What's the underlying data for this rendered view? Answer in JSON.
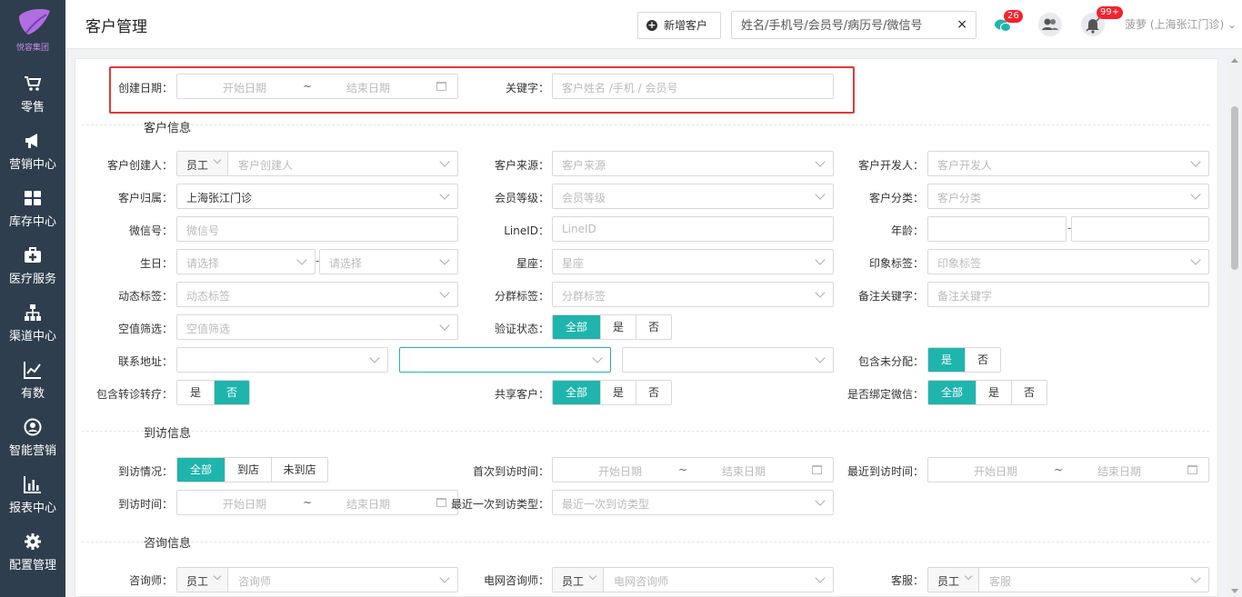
{
  "brand": {
    "logo_text": "悦容集团",
    "accent": "#1fb5ad",
    "sidebar_bg": "#2f3e4e"
  },
  "sidebar": {
    "items": [
      {
        "label": "零售",
        "icon": "cart-icon"
      },
      {
        "label": "营销中心",
        "icon": "megaphone-icon"
      },
      {
        "label": "库存中心",
        "icon": "grid-icon"
      },
      {
        "label": "医疗服务",
        "icon": "medkit-icon"
      },
      {
        "label": "渠道中心",
        "icon": "sitemap-icon"
      },
      {
        "label": "有数",
        "icon": "line-chart-icon"
      },
      {
        "label": "智能营销",
        "icon": "user-circle-icon"
      },
      {
        "label": "报表中心",
        "icon": "bar-chart-icon"
      },
      {
        "label": "配置管理",
        "icon": "gear-icon"
      }
    ]
  },
  "header": {
    "title": "客户管理",
    "new_button": "新增客户",
    "search_placeholder": "姓名/手机号/会员号/病历号/微信号",
    "clear": "×",
    "wechat_badge": "26",
    "notify_badge": "99+",
    "user": "菠萝 (上海张江门诊) ⌄"
  },
  "filters": {
    "top": {
      "create_date_label": "创建日期：",
      "start_date": "开始日期",
      "tilde": "~",
      "end_date": "结束日期",
      "keyword_label": "关键字：",
      "keyword_placeholder": "客户姓名 /手机 / 会员号"
    },
    "customer_info": {
      "title": "客户信息",
      "creator_label": "客户创建人：",
      "creator_prefix": "员工",
      "creator_placeholder": "客户创建人",
      "source_label": "客户来源：",
      "source_placeholder": "客户来源",
      "developer_label": "客户开发人：",
      "developer_placeholder": "客户开发人",
      "belong_label": "客户归属：",
      "belong_value": "上海张江门诊",
      "level_label": "会员等级：",
      "level_placeholder": "会员等级",
      "category_label": "客户分类：",
      "category_placeholder": "客户分类",
      "wechat_label": "微信号：",
      "wechat_placeholder": "微信号",
      "lineid_label": "LineID：",
      "lineid_placeholder": "LineID",
      "age_label": "年龄：",
      "age_dash": "-",
      "birthday_label": "生日：",
      "birthday_placeholder": "请选择",
      "birthday_dash": "-",
      "zodiac_label": "星座：",
      "zodiac_placeholder": "星座",
      "impression_label": "印象标签：",
      "impression_placeholder": "印象标签",
      "dynamic_label": "动态标签：",
      "dynamic_placeholder": "动态标签",
      "group_label": "分群标签：",
      "group_placeholder": "分群标签",
      "remark_label": "备注关键字：",
      "remark_placeholder": "备注关键字",
      "empty_label": "空值筛选：",
      "empty_placeholder": "空值筛选",
      "verify_label": "验证状态：",
      "verify_options": [
        "全部",
        "是",
        "否"
      ],
      "address_label": "联系地址：",
      "unassigned_label": "包含未分配：",
      "unassigned_options": [
        "是",
        "否"
      ],
      "transfer_label": "包含转诊转疗：",
      "transfer_options": [
        "是",
        "否"
      ],
      "shared_label": "共享客户：",
      "shared_options": [
        "全部",
        "是",
        "否"
      ],
      "bind_label": "是否绑定微信：",
      "bind_options": [
        "全部",
        "是",
        "否"
      ]
    },
    "visit_info": {
      "title": "到访信息",
      "status_label": "到访情况：",
      "status_options": [
        "全部",
        "到店",
        "未到店"
      ],
      "first_label": "首次到访时间：",
      "recent_label": "最近到访时间：",
      "time_label": "到访时间：",
      "recent_type_label": "最近一次到访类型：",
      "recent_type_placeholder": "最近一次到访类型",
      "start_date": "开始日期",
      "end_date": "结束日期",
      "tilde": "~"
    },
    "consult_info": {
      "title": "咨询信息",
      "consultant_label": "咨询师：",
      "consultant_prefix": "员工",
      "consultant_placeholder": "咨询师",
      "online_label": "电网咨询师：",
      "online_prefix": "员工",
      "online_placeholder": "电网咨询师",
      "service_label": "客服：",
      "service_prefix": "员工",
      "service_placeholder": "客服"
    }
  }
}
